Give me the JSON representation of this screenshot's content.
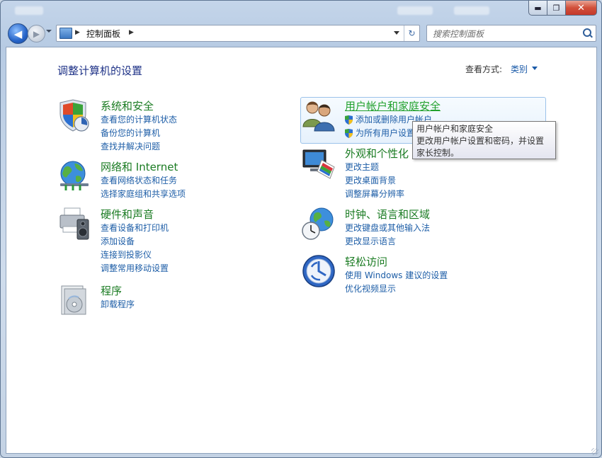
{
  "window": {
    "controls": {
      "minimize": "▬",
      "maximize": "❐",
      "close": "✕"
    }
  },
  "nav": {
    "back_glyph": "◀",
    "forward_glyph": "▶",
    "breadcrumb": "控制面板",
    "refresh_glyph": "↻",
    "search_placeholder": "搜索控制面板"
  },
  "page": {
    "title": "调整计算机的设置",
    "view_label": "查看方式:",
    "view_value": "类别"
  },
  "categories": {
    "system": {
      "title": "系统和安全",
      "links": [
        "查看您的计算机状态",
        "备份您的计算机",
        "查找并解决问题"
      ]
    },
    "network": {
      "title": "网络和 Internet",
      "links": [
        "查看网络状态和任务",
        "选择家庭组和共享选项"
      ]
    },
    "hardware": {
      "title": "硬件和声音",
      "links": [
        "查看设备和打印机",
        "添加设备",
        "连接到投影仪",
        "调整常用移动设置"
      ]
    },
    "programs": {
      "title": "程序",
      "links": [
        "卸载程序"
      ]
    },
    "users": {
      "title": "用户帐户和家庭安全",
      "links": [
        "添加或删除用户帐户",
        "为所有用户设置"
      ]
    },
    "appearance": {
      "title": "外观和个性化",
      "links": [
        "更改主题",
        "更改桌面背景",
        "调整屏幕分辨率"
      ]
    },
    "clock": {
      "title": "时钟、语言和区域",
      "links": [
        "更改键盘或其他输入法",
        "更改显示语言"
      ]
    },
    "ease": {
      "title": "轻松访问",
      "links": [
        "使用 Windows 建议的设置",
        "优化视频显示"
      ]
    }
  },
  "tooltip": {
    "title": "用户帐户和家庭安全",
    "body": "更改用户帐户设置和密码，并设置家长控制。"
  },
  "colors": {
    "category_title": "#1a7b22",
    "link": "#1e5ea7",
    "page_title": "#1e3287"
  }
}
